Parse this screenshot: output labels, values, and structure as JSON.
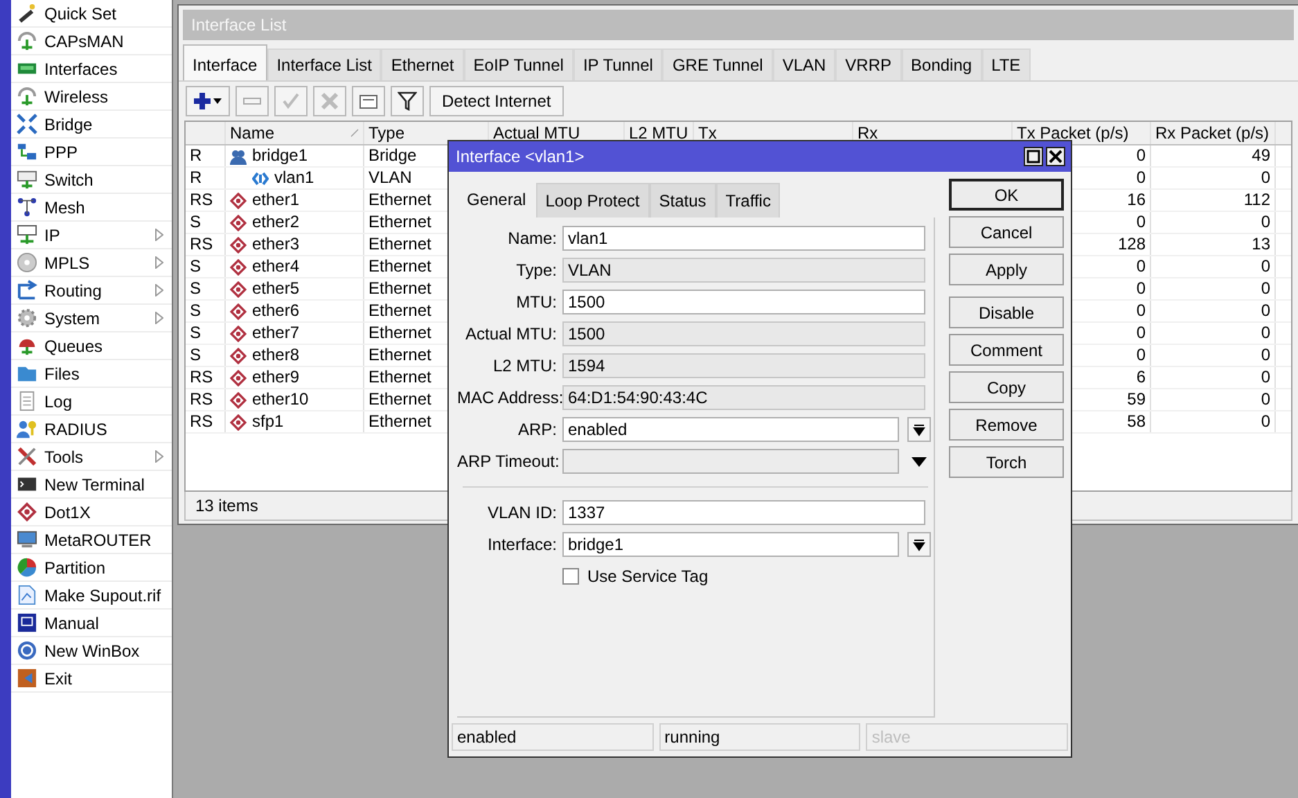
{
  "menu": [
    {
      "label": "Quick Set",
      "submenu": false
    },
    {
      "label": "CAPsMAN",
      "submenu": false
    },
    {
      "label": "Interfaces",
      "submenu": false
    },
    {
      "label": "Wireless",
      "submenu": false
    },
    {
      "label": "Bridge",
      "submenu": false
    },
    {
      "label": "PPP",
      "submenu": false
    },
    {
      "label": "Switch",
      "submenu": false
    },
    {
      "label": "Mesh",
      "submenu": false
    },
    {
      "label": "IP",
      "submenu": true
    },
    {
      "label": "MPLS",
      "submenu": true
    },
    {
      "label": "Routing",
      "submenu": true
    },
    {
      "label": "System",
      "submenu": true
    },
    {
      "label": "Queues",
      "submenu": false
    },
    {
      "label": "Files",
      "submenu": false
    },
    {
      "label": "Log",
      "submenu": false
    },
    {
      "label": "RADIUS",
      "submenu": false
    },
    {
      "label": "Tools",
      "submenu": true
    },
    {
      "label": "New Terminal",
      "submenu": false
    },
    {
      "label": "Dot1X",
      "submenu": false
    },
    {
      "label": "MetaROUTER",
      "submenu": false
    },
    {
      "label": "Partition",
      "submenu": false
    },
    {
      "label": "Make Supout.rif",
      "submenu": false
    },
    {
      "label": "Manual",
      "submenu": false
    },
    {
      "label": "New WinBox",
      "submenu": false
    },
    {
      "label": "Exit",
      "submenu": false
    }
  ],
  "interface_list": {
    "title": "Interface List",
    "tabs": [
      {
        "label": "Interface",
        "selected": true
      },
      {
        "label": "Interface List",
        "selected": false
      },
      {
        "label": "Ethernet",
        "selected": false
      },
      {
        "label": "EoIP Tunnel",
        "selected": false
      },
      {
        "label": "IP Tunnel",
        "selected": false
      },
      {
        "label": "GRE Tunnel",
        "selected": false
      },
      {
        "label": "VLAN",
        "selected": false
      },
      {
        "label": "VRRP",
        "selected": false
      },
      {
        "label": "Bonding",
        "selected": false
      },
      {
        "label": "LTE",
        "selected": false
      }
    ],
    "toolbar": {
      "detect_button": "Detect Internet"
    },
    "table": {
      "columns": [
        "Name",
        "Type",
        "Actual MTU",
        "L2 MTU",
        "Tx",
        "Rx",
        "Tx Packet (p/s)",
        "Rx Packet (p/s)"
      ],
      "rows": [
        {
          "flags": "R",
          "name": "bridge1",
          "type": "Bridge",
          "kind": "bridge",
          "tx_packet": "0",
          "rx_packet": "49",
          "children": [
            {
              "flags": "R",
              "name": "vlan1",
              "type": "VLAN",
              "kind": "vlan",
              "tx_packet": "0",
              "rx_packet": "0"
            }
          ]
        },
        {
          "flags": "RS",
          "name": "ether1",
          "type": "Ethernet",
          "kind": "ethernet",
          "tx_packet": "16",
          "rx_packet": "112"
        },
        {
          "flags": "S",
          "name": "ether2",
          "type": "Ethernet",
          "kind": "ethernet",
          "tx_packet": "0",
          "rx_packet": "0"
        },
        {
          "flags": "RS",
          "name": "ether3",
          "type": "Ethernet",
          "kind": "ethernet",
          "tx_packet": "128",
          "rx_packet": "13"
        },
        {
          "flags": "S",
          "name": "ether4",
          "type": "Ethernet",
          "kind": "ethernet",
          "tx_packet": "0",
          "rx_packet": "0"
        },
        {
          "flags": "S",
          "name": "ether5",
          "type": "Ethernet",
          "kind": "ethernet",
          "tx_packet": "0",
          "rx_packet": "0"
        },
        {
          "flags": "S",
          "name": "ether6",
          "type": "Ethernet",
          "kind": "ethernet",
          "tx_packet": "0",
          "rx_packet": "0"
        },
        {
          "flags": "S",
          "name": "ether7",
          "type": "Ethernet",
          "kind": "ethernet",
          "tx_packet": "0",
          "rx_packet": "0"
        },
        {
          "flags": "S",
          "name": "ether8",
          "type": "Ethernet",
          "kind": "ethernet",
          "tx_packet": "0",
          "rx_packet": "0"
        },
        {
          "flags": "RS",
          "name": "ether9",
          "type": "Ethernet",
          "kind": "ethernet",
          "tx_packet": "6",
          "rx_packet": "0"
        },
        {
          "flags": "RS",
          "name": "ether10",
          "type": "Ethernet",
          "kind": "ethernet",
          "tx_packet": "59",
          "rx_packet": "0"
        },
        {
          "flags": "RS",
          "name": "sfp1",
          "type": "Ethernet",
          "kind": "ethernet",
          "tx_packet": "58",
          "rx_packet": "0"
        }
      ]
    },
    "status": "13 items"
  },
  "dialog": {
    "title": "Interface <vlan1>",
    "tabs": [
      {
        "label": "General",
        "selected": true
      },
      {
        "label": "Loop Protect",
        "selected": false
      },
      {
        "label": "Status",
        "selected": false
      },
      {
        "label": "Traffic",
        "selected": false
      }
    ],
    "fields": [
      {
        "label": "Name:",
        "value": "vlan1",
        "kind": "text"
      },
      {
        "label": "Type:",
        "value": "VLAN",
        "kind": "readonly"
      },
      {
        "label": "MTU:",
        "value": "1500",
        "kind": "text"
      },
      {
        "label": "Actual MTU:",
        "value": "1500",
        "kind": "readonly"
      },
      {
        "label": "L2 MTU:",
        "value": "1594",
        "kind": "readonly"
      },
      {
        "label": "MAC Address:",
        "value": "64:D1:54:90:43:4C",
        "kind": "readonly"
      },
      {
        "label": "ARP:",
        "value": "enabled",
        "kind": "dropdown"
      },
      {
        "label": "ARP Timeout:",
        "kind": "combo"
      }
    ],
    "vlan_fields": [
      {
        "label": "VLAN ID:",
        "value": "1337",
        "kind": "text"
      },
      {
        "label": "Interface:",
        "value": "bridge1",
        "kind": "dropdown"
      }
    ],
    "checkbox": {
      "label": "Use Service Tag",
      "checked": false
    },
    "button_groups": [
      [
        {
          "label": "OK",
          "default": true
        },
        {
          "label": "Cancel",
          "default": false
        },
        {
          "label": "Apply",
          "default": false
        }
      ],
      [
        {
          "label": "Disable",
          "default": false
        },
        {
          "label": "Comment",
          "default": false
        },
        {
          "label": "Copy",
          "default": false
        },
        {
          "label": "Remove",
          "default": false
        },
        {
          "label": "Torch",
          "default": false
        }
      ]
    ],
    "status_bar": [
      {
        "text": "enabled",
        "disabled": false
      },
      {
        "text": "running",
        "disabled": false
      },
      {
        "text": "slave",
        "disabled": true
      }
    ]
  }
}
